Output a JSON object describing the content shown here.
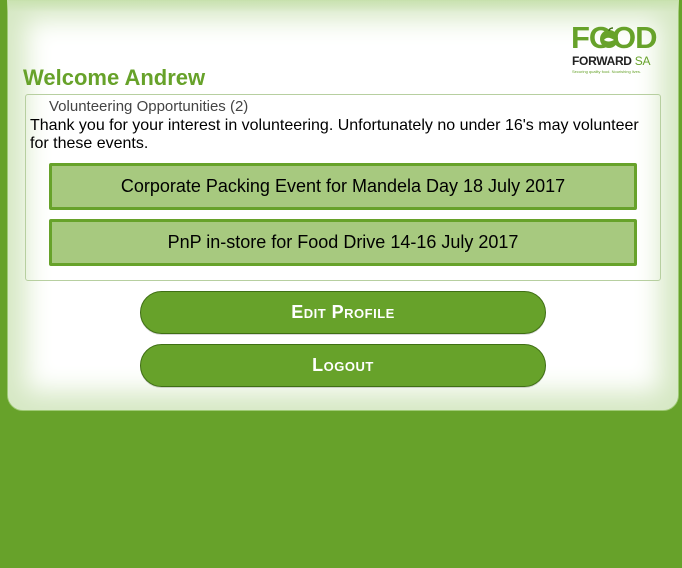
{
  "logo": {
    "word_food": "FOOD",
    "word_forward": "FORWARD",
    "word_sa": "SA",
    "tagline": "Securing quality food. Nourishing lives.",
    "brand_color": "#67a22a"
  },
  "header": {
    "welcome": "Welcome Andrew"
  },
  "volunteering": {
    "legend": "Volunteering Opportunities (2)",
    "note": "Thank you for your interest in volunteering. Unfortunately no under 16's may volunteer for these events.",
    "events": [
      {
        "label": "Corporate Packing Event for Mandela Day 18 July 2017"
      },
      {
        "label": "PnP in-store for Food Drive 14-16 July 2017"
      }
    ]
  },
  "actions": {
    "edit_profile": "Edit Profile",
    "logout": "Logout"
  },
  "colors": {
    "accent": "#67a22a",
    "event_fill": "#a7c97f"
  }
}
